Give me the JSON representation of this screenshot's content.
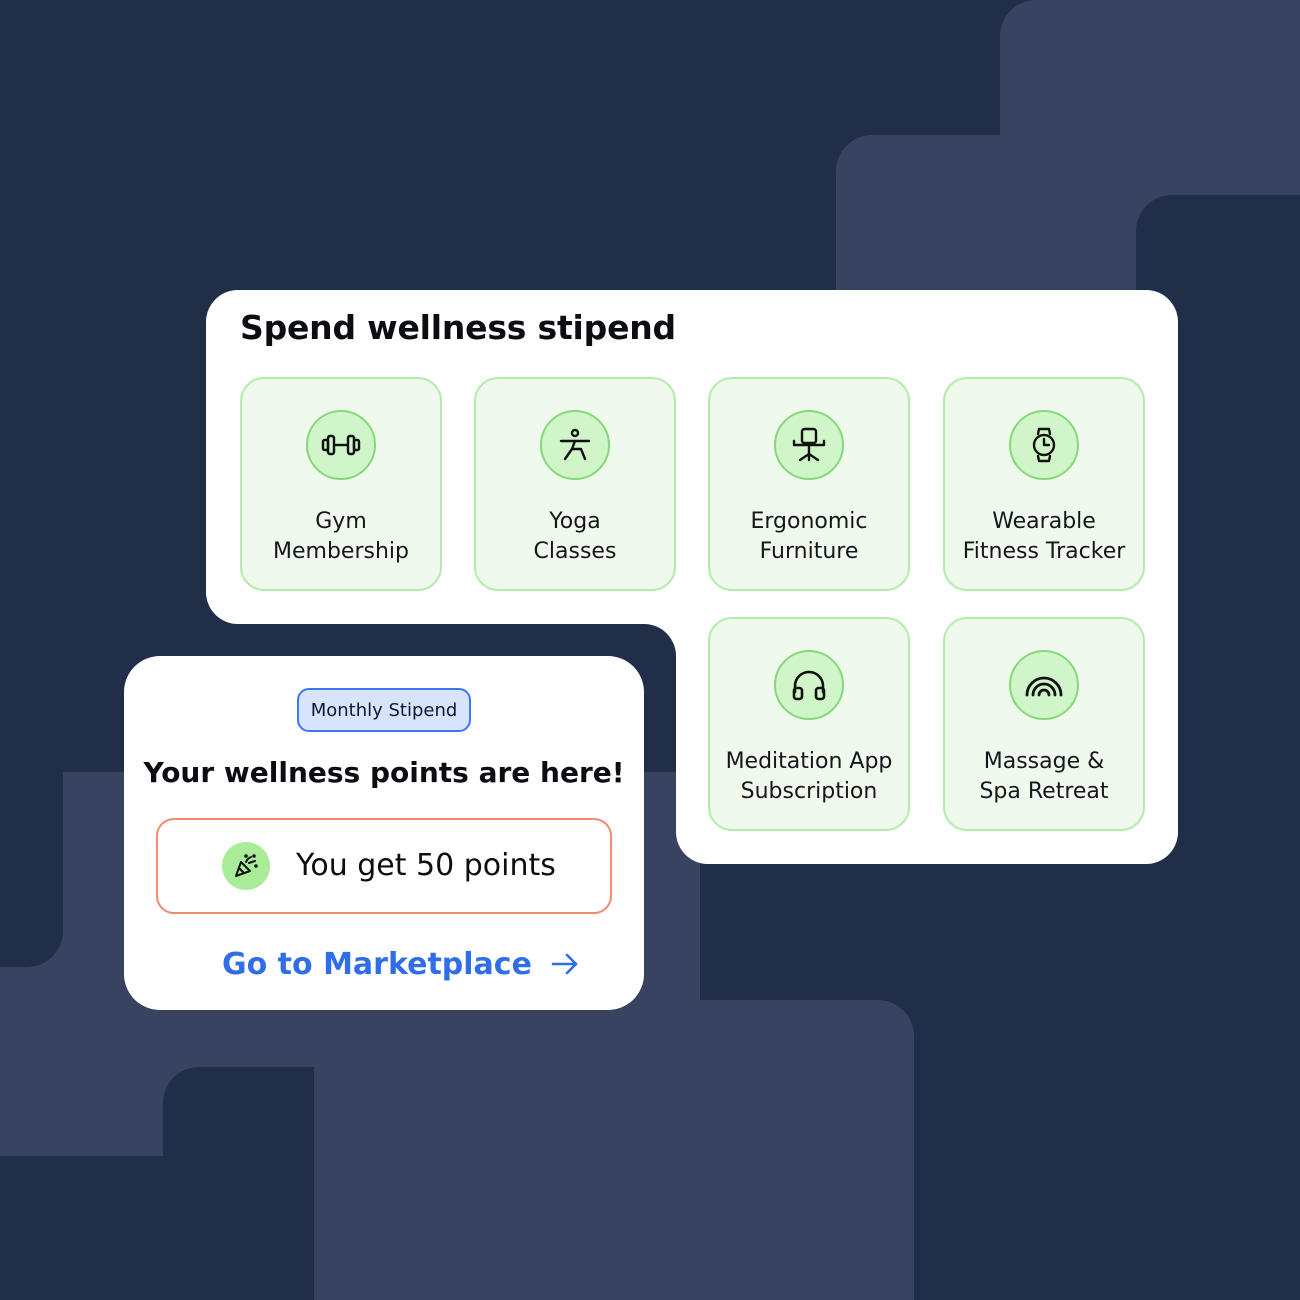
{
  "stipend": {
    "title": "Spend wellness stipend",
    "items": [
      {
        "line1": "Gym",
        "line2": "Membership",
        "icon": "dumbbell-icon"
      },
      {
        "line1": "Yoga",
        "line2": "Classes",
        "icon": "yoga-pose-icon"
      },
      {
        "line1": "Ergonomic",
        "line2": "Furniture",
        "icon": "office-chair-icon"
      },
      {
        "line1": "Wearable",
        "line2": "Fitness Tracker",
        "icon": "smartwatch-icon"
      },
      {
        "line1": "Meditation App",
        "line2": "Subscription",
        "icon": "headphones-icon"
      },
      {
        "line1": "Massage &",
        "line2": "Spa Retreat",
        "icon": "rainbow-icon"
      }
    ]
  },
  "reward": {
    "badge": "Monthly Stipend",
    "headline": "Your wellness points are here!",
    "points_text": "You get 50 points",
    "points_icon": "party-popper-icon",
    "cta_label": "Go to Marketplace",
    "cta_icon": "arrow-right-icon"
  },
  "colors": {
    "background": "#212e48",
    "accent_blue": "#2f6ee8",
    "tile_green": "#effaec",
    "points_border": "#f28a6c"
  }
}
